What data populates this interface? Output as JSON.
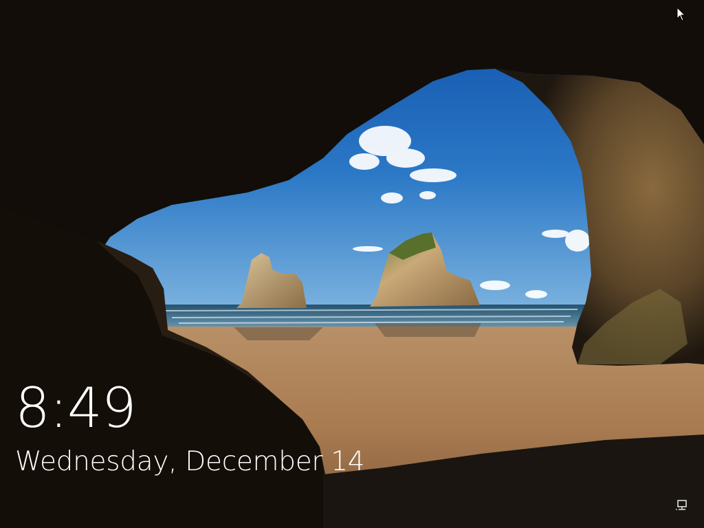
{
  "lock_screen": {
    "time": "8:49",
    "date": "Wednesday, December 14"
  },
  "icons": {
    "cursor": "mouse-pointer-icon",
    "network": "network-monitor-icon"
  },
  "colors": {
    "text": "#ffffff",
    "sky_top": "#1c5fb3",
    "sky_bottom": "#6ea8dc",
    "sea": "#3d6a8a",
    "sand": "#b5865a",
    "cave_rock": "#2a2017"
  }
}
